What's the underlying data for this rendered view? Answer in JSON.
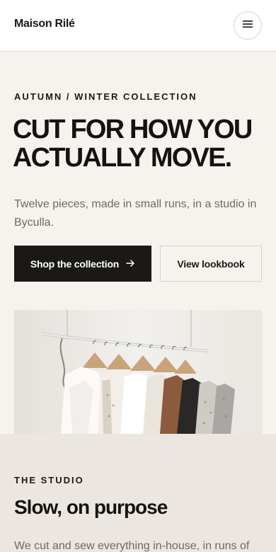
{
  "header": {
    "brand": "Maison Rilé",
    "menu_icon": "hamburger-menu-icon"
  },
  "hero": {
    "eyebrow": "AUTUMN / WINTER COLLECTION",
    "headline": "CUT FOR HOW YOU ACTUALLY MOVE.",
    "lede": "Twelve pieces, made in small runs, in a studio in Byculla.",
    "primary_cta": "Shop the collection",
    "primary_cta_icon": "arrow-right-icon",
    "secondary_cta": "View lookbook"
  },
  "studio": {
    "eyebrow": "THE STUDIO",
    "title": "Slow, on purpose",
    "body": "We cut and sew everything in-house, in runs of"
  },
  "colors": {
    "background": "#f6f3ee",
    "ink": "#1b1916",
    "muted": "#6f6960",
    "studio_bg": "#ebe6df"
  }
}
